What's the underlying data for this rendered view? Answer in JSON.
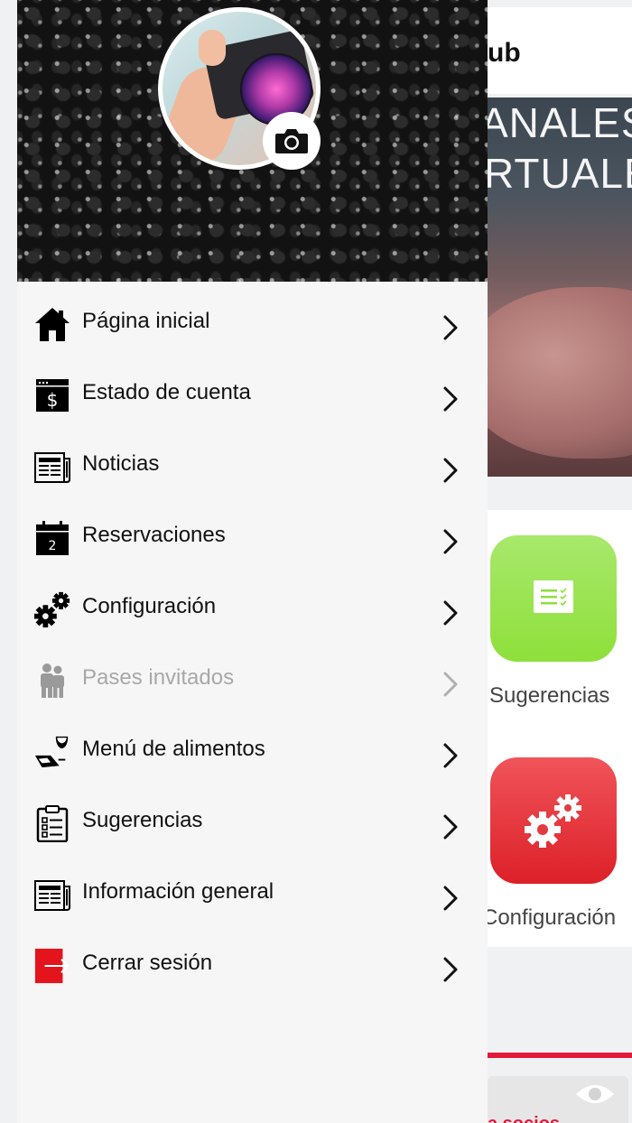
{
  "background": {
    "header_title_partial": "ub",
    "banner_text_lines": [
      "ANALES",
      "RTUALE"
    ],
    "tiles": [
      {
        "label": "Sugerencias",
        "color": "#8ee03a",
        "icon": "checklist-icon"
      },
      {
        "label": "Configuración",
        "color": "#dc2028",
        "icon": "gears-icon"
      }
    ],
    "notice_partial": "a socios",
    "accent_color": "#e3193b"
  },
  "drawer": {
    "header_icon": "camera-icon",
    "menu": [
      {
        "label": "Página inicial",
        "icon": "home-icon",
        "enabled": true
      },
      {
        "label": "Estado de cuenta",
        "icon": "account-statement-icon",
        "enabled": true
      },
      {
        "label": "Noticias",
        "icon": "newspaper-icon",
        "enabled": true
      },
      {
        "label": "Reservaciones",
        "icon": "calendar-icon",
        "enabled": true
      },
      {
        "label": "Configuración",
        "icon": "gears-icon",
        "enabled": true
      },
      {
        "label": "Pases invitados",
        "icon": "guests-icon",
        "enabled": false
      },
      {
        "label": "Menú de alimentos",
        "icon": "food-menu-icon",
        "enabled": true
      },
      {
        "label": "Sugerencias",
        "icon": "clipboard-icon",
        "enabled": true
      },
      {
        "label": "Información general",
        "icon": "newspaper-icon",
        "enabled": true
      },
      {
        "label": "Cerrar sesión",
        "icon": "logout-icon",
        "enabled": true
      }
    ],
    "calendar_day": "2"
  }
}
